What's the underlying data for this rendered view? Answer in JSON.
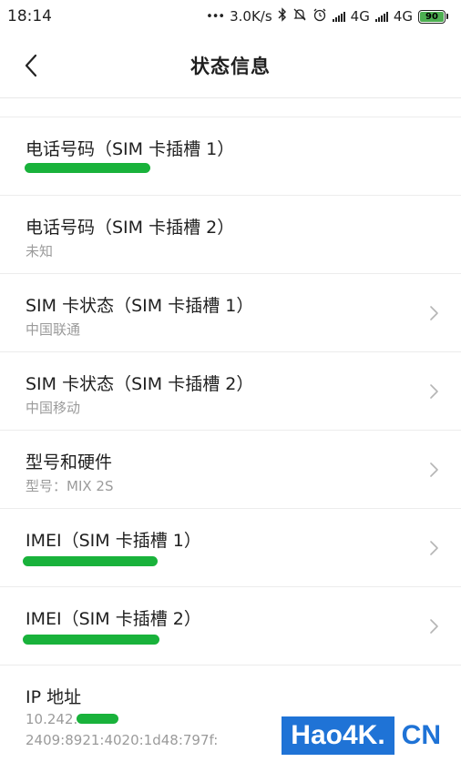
{
  "status_bar": {
    "time": "18:14",
    "dots": "•••",
    "net_speed": "3.0K/s",
    "sim1_type": "4G",
    "sim2_type": "4G",
    "battery": "90",
    "battery_color": "#4caf50"
  },
  "header": {
    "title": "状态信息",
    "back_icon": "chevron-left-icon"
  },
  "rows": [
    {
      "title": "电话号码（SIM 卡插槽 1）",
      "sub": "",
      "redacted": true
    },
    {
      "title": "电话号码（SIM 卡插槽 2）",
      "sub": "未知"
    },
    {
      "title": "SIM 卡状态（SIM 卡插槽 1）",
      "sub": "中国联通"
    },
    {
      "title": "SIM 卡状态（SIM 卡插槽 2）",
      "sub": "中国移动"
    },
    {
      "title": "型号和硬件",
      "sub": "型号：MIX 2S"
    },
    {
      "title": "IMEI（SIM 卡插槽 1）",
      "sub": "",
      "redacted": true
    },
    {
      "title": "IMEI（SIM 卡插槽 2）",
      "sub": "",
      "redacted": true
    },
    {
      "title": "IP 地址",
      "sub": "10.242.",
      "sub2": "2409:8921:4020:1d48:797f:"
    }
  ],
  "watermark": {
    "main": "Hao4K.",
    "tld": "CN",
    "color": "#1f73d6"
  }
}
